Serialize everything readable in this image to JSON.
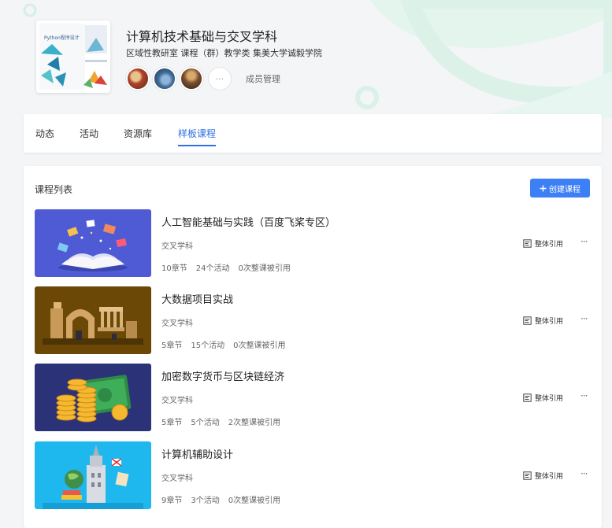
{
  "group": {
    "title": "计算机技术基础与交叉学科",
    "meta": "区域性教研室 课程（群）教学类 集美大学诚毅学院",
    "cover_text": "Python程序设计",
    "more_members": "···",
    "member_management": "成员管理"
  },
  "tabs": [
    {
      "label": "动态"
    },
    {
      "label": "活动"
    },
    {
      "label": "资源库"
    },
    {
      "label": "样板课程",
      "active": true
    }
  ],
  "course_list": {
    "title": "课程列表",
    "create_label": "创建课程",
    "cite_label": "整体引用",
    "more_label": "···",
    "courses": [
      {
        "title": "人工智能基础与实践（百度飞桨专区）",
        "category": "交叉学科",
        "chapters": "10章节",
        "activities": "24个活动",
        "citations": "0次整课被引用",
        "thumb": "book-illustration"
      },
      {
        "title": "大数据项目实战",
        "category": "交叉学科",
        "chapters": "5章节",
        "activities": "15个活动",
        "citations": "0次整课被引用",
        "thumb": "data-ruins-illustration"
      },
      {
        "title": "加密数字货币与区块链经济",
        "category": "交叉学科",
        "chapters": "5章节",
        "activities": "5个活动",
        "citations": "2次整课被引用",
        "thumb": "coins-illustration"
      },
      {
        "title": "计算机辅助设计",
        "category": "交叉学科",
        "chapters": "9章节",
        "activities": "3个活动",
        "citations": "0次整课被引用",
        "thumb": "tower-illustration"
      }
    ]
  },
  "colors": {
    "accent": "#3d7ff5",
    "tab_active": "#2f6fe0",
    "deco_green": "#d8f2e8"
  },
  "icons": {
    "create": "plus-icon",
    "cite": "cite-icon",
    "more": "more-icon"
  }
}
